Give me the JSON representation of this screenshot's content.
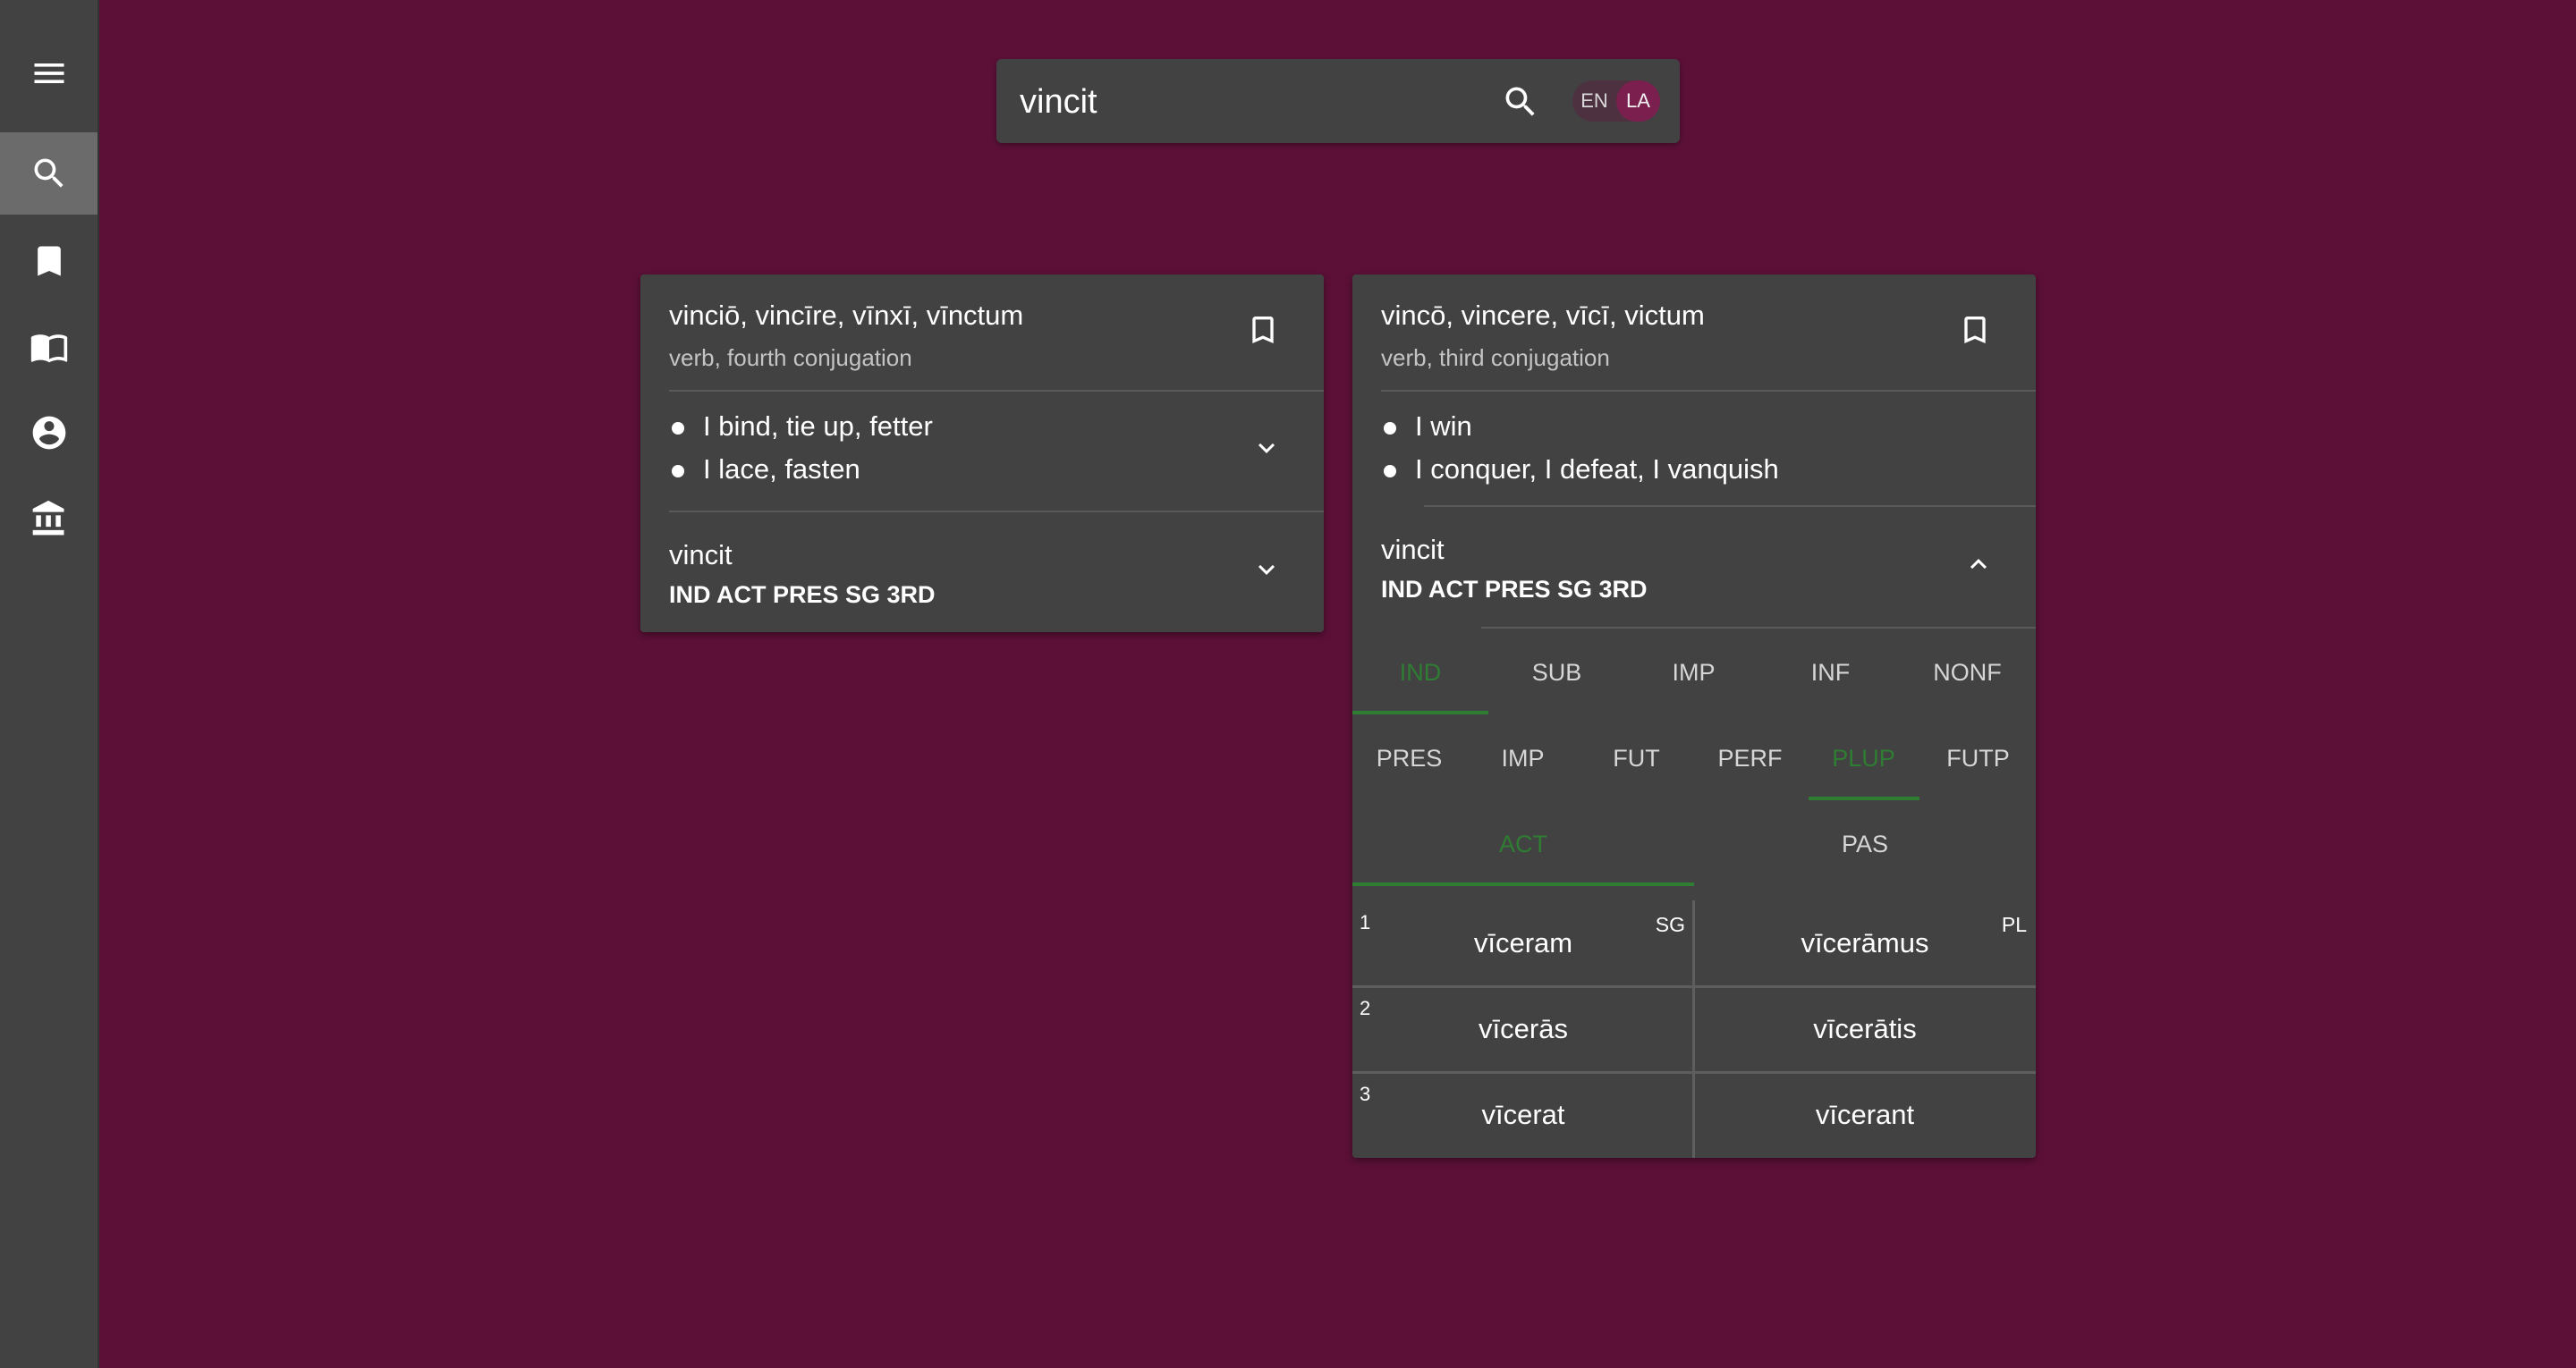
{
  "sidebar": {
    "items": [
      {
        "icon": "menu-icon"
      },
      {
        "icon": "search-icon",
        "active": true
      },
      {
        "icon": "bookmark-icon"
      },
      {
        "icon": "book-icon"
      },
      {
        "icon": "account-icon"
      },
      {
        "icon": "institution-icon"
      }
    ]
  },
  "search": {
    "value": "vincit",
    "lang_en": "EN",
    "lang_la": "LA",
    "selected_lang": "LA"
  },
  "cards": [
    {
      "title": "vinciō, vincīre, vīnxī, vīnctum",
      "subtitle": "verb, fourth conjugation",
      "definitions": [
        "I bind, tie up, fetter",
        "I lace, fasten"
      ],
      "form": {
        "word": "vincit",
        "tags": "IND ACT PRES SG 3RD"
      }
    },
    {
      "title": "vincō, vincere, vīcī, victum",
      "subtitle": "verb, third conjugation",
      "definitions": [
        "I win",
        "I conquer, I defeat, I vanquish"
      ],
      "form": {
        "word": "vincit",
        "tags": "IND ACT PRES SG 3RD"
      },
      "mood_tabs": [
        "IND",
        "SUB",
        "IMP",
        "INF",
        "NONF"
      ],
      "mood_active": "IND",
      "tense_tabs": [
        "PRES",
        "IMP",
        "FUT",
        "PERF",
        "PLUP",
        "FUTP"
      ],
      "tense_active": "PLUP",
      "voice_tabs": [
        "ACT",
        "PAS"
      ],
      "voice_active": "ACT",
      "table": {
        "sg_label": "SG",
        "pl_label": "PL",
        "rows": [
          {
            "person": "1",
            "sg": "vīceram",
            "pl": "vīcerāmus"
          },
          {
            "person": "2",
            "sg": "vīcerās",
            "pl": "vīcerātis"
          },
          {
            "person": "3",
            "sg": "vīcerat",
            "pl": "vīcerant"
          }
        ]
      }
    }
  ],
  "colors": {
    "background": "#5c1037",
    "surface": "#424242",
    "accent_green": "#2e7d32"
  }
}
